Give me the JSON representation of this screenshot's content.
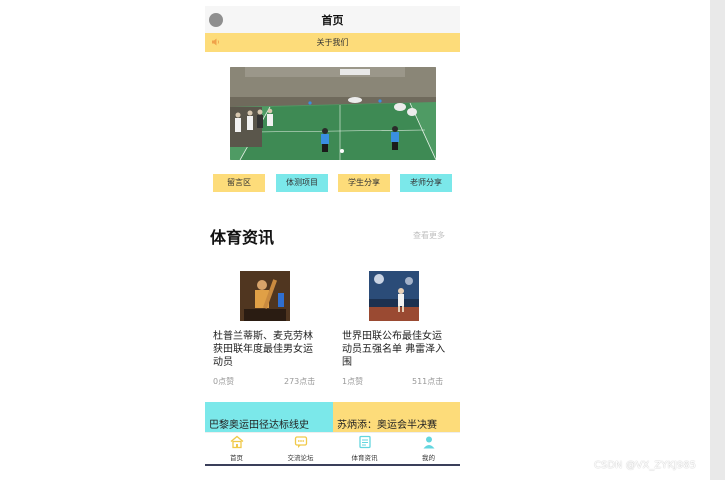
{
  "header": {
    "title": "首页"
  },
  "notice": {
    "text": "关于我们"
  },
  "quick_links": [
    "留言区",
    "体测项目",
    "学生分享",
    "老师分享"
  ],
  "news_section": {
    "title": "体育资讯",
    "more": "查看更多"
  },
  "news": [
    {
      "title": "杜普兰蒂斯、麦克劳林获田联年度最佳男女运动员",
      "likes": "0点赞",
      "clicks": "273点击"
    },
    {
      "title": "世界田联公布最佳女运动员五强名单 弗雷泽入围",
      "likes": "1点赞",
      "clicks": "511点击"
    }
  ],
  "cards": [
    {
      "text": "巴黎奥运田径达标线史",
      "color": "#7be8ea"
    },
    {
      "text": "苏炳添：奥运会半决赛",
      "color": "#fddc7a"
    }
  ],
  "tabs": [
    {
      "label": "首页",
      "icon": "home-icon"
    },
    {
      "label": "交流论坛",
      "icon": "forum-icon"
    },
    {
      "label": "体育资讯",
      "icon": "news-icon"
    },
    {
      "label": "我的",
      "icon": "user-icon"
    }
  ],
  "colors": {
    "yellow": "#fddc7a",
    "cyan": "#7be8ea",
    "tab_accent": "#f0c94a",
    "tab_cyan": "#63d6df"
  },
  "watermark": "CSDN @VX_ZYKJ985"
}
